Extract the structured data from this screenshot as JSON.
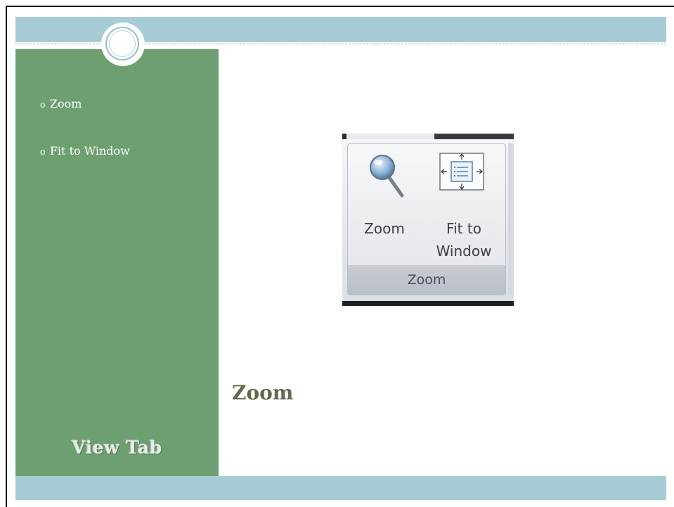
{
  "slide": {
    "sidebar": {
      "bullets": [
        {
          "marker": "o",
          "text": "Zoom"
        },
        {
          "marker": "o",
          "text": "Fit to Window"
        }
      ],
      "section_title": "View Tab"
    },
    "main": {
      "title": "Zoom"
    },
    "ribbon_image": {
      "buttons": [
        {
          "label": "Zoom",
          "icon": "magnifier-icon"
        },
        {
          "label_line1": "Fit to",
          "label_line2": "Window",
          "icon": "fit-to-window-icon"
        }
      ],
      "group_label": "Zoom"
    }
  },
  "colors": {
    "sidebar_green": "#6e9f70",
    "band_blue": "#a7ccd5",
    "title_color": "#5e6b4c"
  }
}
